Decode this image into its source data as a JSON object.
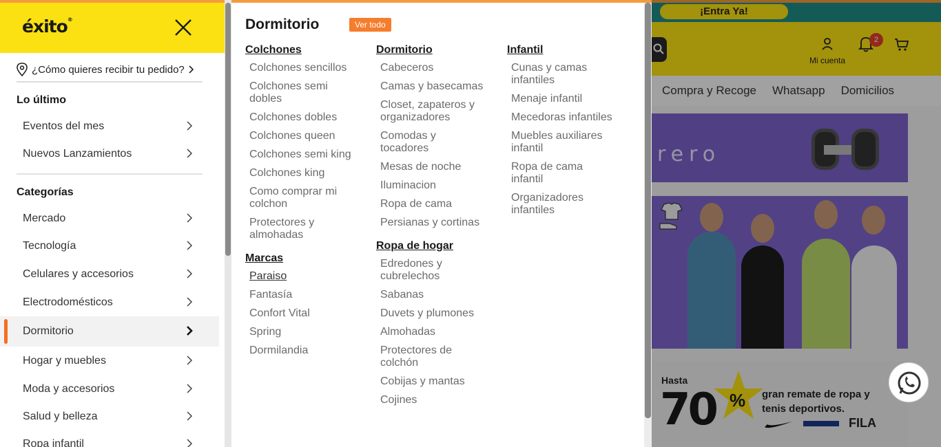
{
  "background": {
    "promo_bar": "¡Entra Ya!",
    "account_label": "Mi cuenta",
    "notifications_count": "2",
    "nav_links": [
      "Compra y Recoge",
      "Whatsapp",
      "Domicilios"
    ],
    "banner1_word": "rero",
    "banner3": {
      "hasta": "Hasta",
      "discount": "70",
      "percent": "%",
      "promo_text": "gran remate de ropa y tenis deportivos.",
      "brands": "FILA"
    }
  },
  "drawer": {
    "logo": "éxito",
    "delivery_prompt": "¿Cómo quieres recibir tu pedido?",
    "sections": {
      "latest_title": "Lo último",
      "latest_items": [
        "Eventos del mes",
        "Nuevos Lanzamientos"
      ],
      "categories_title": "Categorías",
      "categories": [
        "Mercado",
        "Tecnología",
        "Celulares y accesorios",
        "Electrodomésticos",
        "Dormitorio",
        "Hogar y muebles",
        "Moda y accesorios",
        "Salud y belleza",
        "Ropa infantil"
      ]
    },
    "active_category": "Dormitorio"
  },
  "panel": {
    "title": "Dormitorio",
    "see_all": "Ver todo",
    "columns": [
      {
        "groups": [
          {
            "title": "Colchones",
            "items": [
              "Colchones sencillos",
              "Colchones semi dobles",
              "Colchones dobles",
              "Colchones queen",
              "Colchones semi king",
              "Colchones king",
              "Como comprar mi colchon",
              "Protectores y almohadas"
            ]
          },
          {
            "title": "Marcas",
            "items": [
              "Paraiso",
              "Fantasía",
              "Confort Vital",
              "Spring",
              "Dormilandia"
            ]
          }
        ]
      },
      {
        "groups": [
          {
            "title": "Dormitorio",
            "items": [
              "Cabeceros",
              "Camas y basecamas",
              "Closet, zapateros y organizadores",
              "Comodas y tocadores",
              "Mesas de noche",
              "Iluminacion",
              "Ropa de cama",
              "Persianas y cortinas"
            ]
          },
          {
            "title": "Ropa de hogar",
            "items": [
              "Edredones y cubrelechos",
              "Sabanas",
              "Duvets y plumones",
              "Almohadas",
              "Protectores de colchón",
              "Cobijas y mantas",
              "Cojines"
            ]
          }
        ]
      },
      {
        "groups": [
          {
            "title": "Infantil",
            "items": [
              "Cunas y camas infantiles",
              "Menaje infantil",
              "Mecedoras infantiles",
              "Muebles auxiliares infantil",
              "Ropa de cama infantil",
              "Organizadores infantiles"
            ]
          }
        ]
      }
    ]
  },
  "colors": {
    "brand_yellow": "#fbe112",
    "accent_orange": "#f57d2d",
    "active_indicator": "#f36f21"
  }
}
